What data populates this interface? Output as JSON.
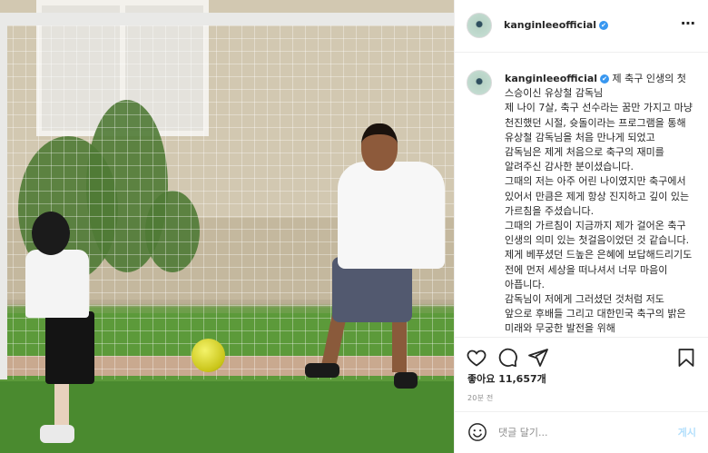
{
  "post": {
    "username": "kanginleeofficial",
    "verified_mark": "✔",
    "more_icon": "⋯",
    "caption_lines": [
      "제 축구 인생의 첫 스승이신 유상철 감독님",
      "제 나이 7살, 축구 선수라는 꿈만 가지고 마냥 천진했던 시절, 슛돌이라는 프로그램을 통해 유상철 감독님을 처음 만나게 되었고 감독님은 제게 처음으로 축구의 재미를 알려주신 감사한 분이셨습니다.",
      "그때의 저는 아주 어린 나이였지만 축구에서 있어서 만큼은 제게 항상 진지하고 깊이 있는 가르침을 주셨습니다.",
      "그때의 가르침이 지금까지 제가 걸어온 축구 인생의 의미 있는 첫걸음이었던 것 같습니다.",
      "제게 베푸셨던 드높은 은혜에 보답해드리기도 전에 먼저 세상을 떠나셔서 너무 마음이 아픕니다.",
      "감독님이 저에게 그러셨던 것처럼 저도 앞으로 후배들 그리고 대한민국 축구의 밝은 미래와 무궁한 발전을 위해"
    ],
    "likes_label": "좋아요 11,657개",
    "timestamp": "20분 전",
    "comment_placeholder": "댓글 달기...",
    "post_button": "게시"
  },
  "icons": {
    "like": "heart-icon",
    "comment": "comment-icon",
    "share": "share-icon",
    "save": "bookmark-icon",
    "emoji": "emoji-icon",
    "more": "more-icon"
  },
  "colors": {
    "verified": "#3897f0",
    "post_button_disabled": "#b2dffc",
    "text": "#262626",
    "muted": "#8e8e8e"
  }
}
